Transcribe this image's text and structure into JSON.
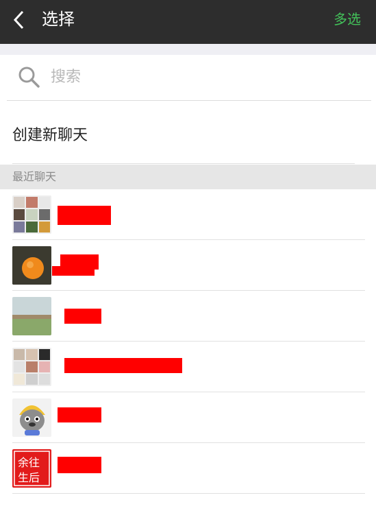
{
  "header": {
    "title": "选择",
    "multi_select": "多选",
    "back_icon": "chevron-left-icon"
  },
  "search": {
    "placeholder": "搜索",
    "icon": "search-icon"
  },
  "create_chat": "创建新聊天",
  "section_title": "最近聊天",
  "colors": {
    "header_bg": "#2d2d2d",
    "accent": "#43c25a",
    "redaction": "#ff0000",
    "section_bg": "#e6e6e6"
  },
  "chats": [
    {
      "avatar": "group-photo-grid"
    },
    {
      "avatar": "orange-fruit-photo"
    },
    {
      "avatar": "landscape-photo"
    },
    {
      "avatar": "group-photo-grid"
    },
    {
      "avatar": "cartoon-wolf-avatar"
    },
    {
      "avatar": "red-seal-avatar",
      "avatar_text": "余生 往后"
    }
  ]
}
